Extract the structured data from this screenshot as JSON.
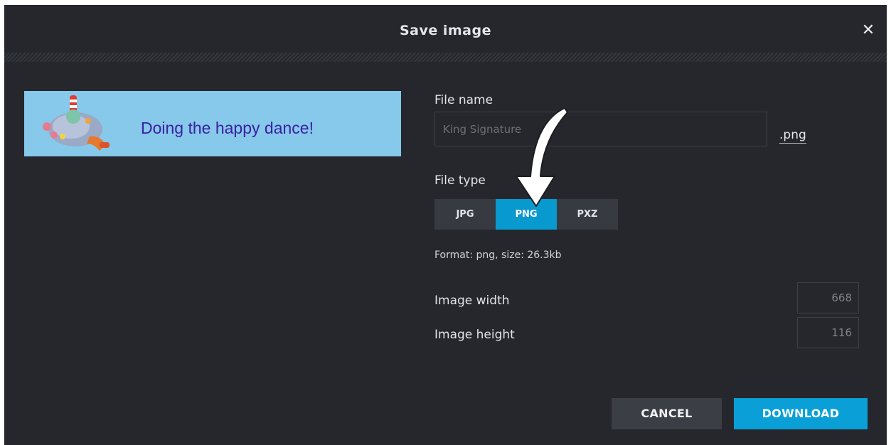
{
  "dialog": {
    "title": "Save image",
    "close_symbol": "✕"
  },
  "preview": {
    "text": "Doing the happy dance!",
    "art_icon": "cartoon-character"
  },
  "form": {
    "file_name_label": "File name",
    "file_name_value": "King Signature",
    "extension": ".png",
    "file_type_label": "File type",
    "file_types": [
      "JPG",
      "PNG",
      "PXZ"
    ],
    "selected_type": "PNG",
    "format_info": "Format: png, size: 26.3kb",
    "width_label": "Image width",
    "width_value": "668",
    "height_label": "Image height",
    "height_value": "116"
  },
  "buttons": {
    "cancel": "CANCEL",
    "download": "DOWNLOAD"
  },
  "colors": {
    "background": "#25272d",
    "accent": "#0a9fd7",
    "preview_bg": "#86c9ea",
    "preview_text": "#3b1fa3"
  }
}
